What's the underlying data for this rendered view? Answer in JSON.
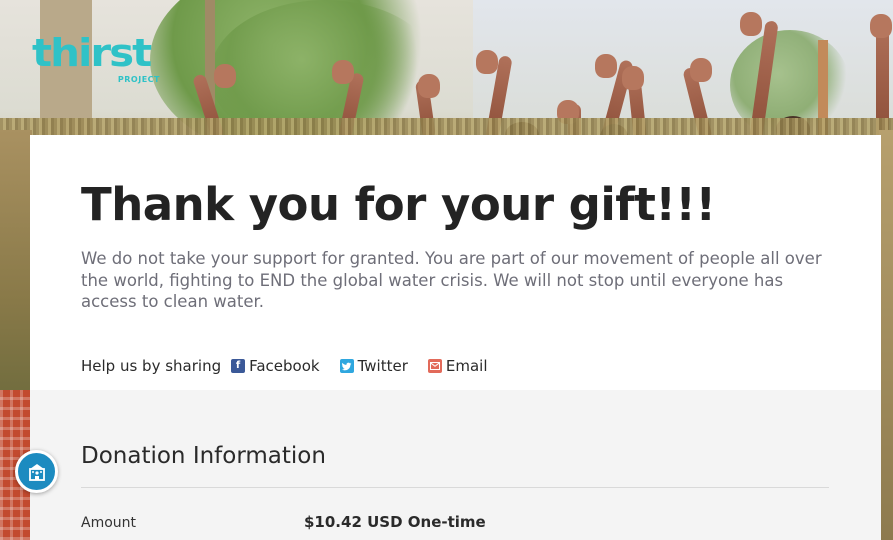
{
  "brand": {
    "logo_word": "thirst",
    "logo_sub": "PROJECT",
    "accent_color": "#2fc2c7"
  },
  "hero": {
    "title": "Thank you for your gift!!!",
    "lead": "We do not take your support for granted. You are part of our movement of people all over the world, fighting to END the global water crisis. We will not stop until everyone has access to clean water."
  },
  "share": {
    "label": "Help us by sharing",
    "links": [
      {
        "label": "Facebook",
        "icon": "facebook-icon",
        "color": "#3b5998"
      },
      {
        "label": "Twitter",
        "icon": "twitter-icon",
        "color": "#2fa7df"
      },
      {
        "label": "Email",
        "icon": "email-icon",
        "color": "#e26a5a"
      }
    ]
  },
  "donation": {
    "section_title": "Donation Information",
    "rows": [
      {
        "label": "Amount",
        "value": "$10.42 USD One-time"
      }
    ]
  },
  "accessibility": {
    "icon": "accessibility-icon",
    "color": "#1c8bc0"
  }
}
